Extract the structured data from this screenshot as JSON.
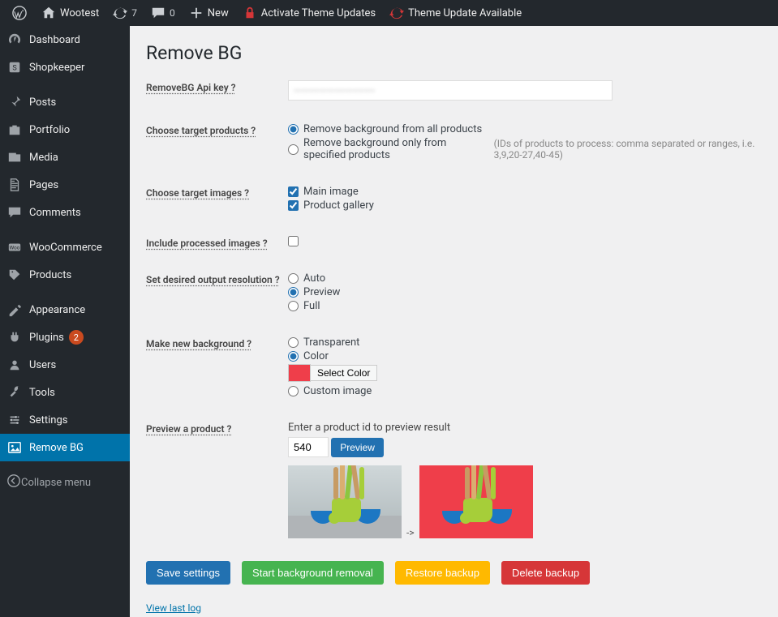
{
  "adminbar": {
    "site_title": "Wootest",
    "updates": "7",
    "comments": "0",
    "new_label": "New",
    "activate_label": "Activate Theme Updates",
    "theme_update_label": "Theme Update Available"
  },
  "sidebar": {
    "items": [
      {
        "label": "Dashboard"
      },
      {
        "label": "Shopkeeper"
      },
      {
        "label": "Posts"
      },
      {
        "label": "Portfolio"
      },
      {
        "label": "Media"
      },
      {
        "label": "Pages"
      },
      {
        "label": "Comments"
      },
      {
        "label": "WooCommerce"
      },
      {
        "label": "Products"
      },
      {
        "label": "Appearance"
      },
      {
        "label": "Plugins",
        "badge": "2"
      },
      {
        "label": "Users"
      },
      {
        "label": "Tools"
      },
      {
        "label": "Settings"
      },
      {
        "label": "Remove BG"
      }
    ],
    "collapse_label": "Collapse menu"
  },
  "page": {
    "title": "Remove BG",
    "api_key_label": "RemoveBG Api key ?",
    "api_key_value": "",
    "target_products_label": "Choose target products ?",
    "target_all": "Remove background from all products",
    "target_specified": "Remove background only from specified products",
    "target_hint": "(IDs of products to process: comma separated or ranges, i.e. 3,9,20-27,40-45)",
    "target_images_label": "Choose target images ?",
    "main_image": "Main image",
    "product_gallery": "Product gallery",
    "include_processed_label": "Include processed images ?",
    "resolution_label": "Set desired output resolution ?",
    "res_auto": "Auto",
    "res_preview": "Preview",
    "res_full": "Full",
    "bg_label": "Make new background ?",
    "bg_transparent": "Transparent",
    "bg_color": "Color",
    "bg_color_value": "#ef3e4a",
    "bg_select_color": "Select Color",
    "bg_custom": "Custom image",
    "preview_label": "Preview a product ?",
    "preview_hint": "Enter a product id to preview result",
    "preview_id": "540",
    "preview_btn": "Preview",
    "arrow": "->",
    "save_btn": "Save settings",
    "start_btn": "Start background removal",
    "restore_btn": "Restore backup",
    "delete_btn": "Delete backup",
    "view_log": "View last log"
  }
}
